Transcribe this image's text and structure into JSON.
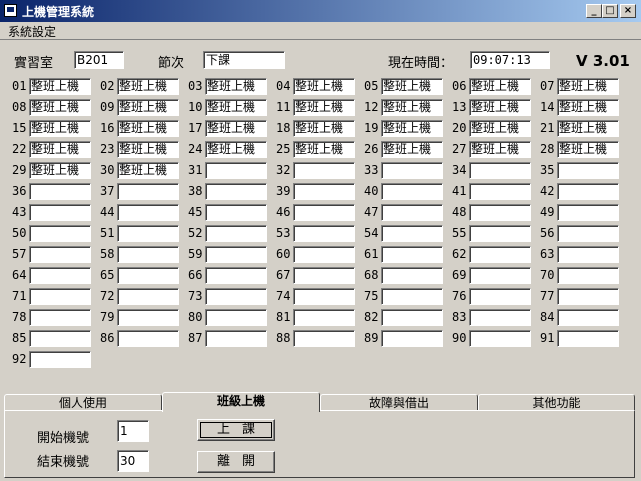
{
  "window": {
    "title": "上機管理系統"
  },
  "menu": {
    "items": [
      "系統設定"
    ]
  },
  "header": {
    "room_label": "實習室",
    "room_value": "B201",
    "period_label": "節次",
    "period_value": "下課",
    "time_label": "現在時間：",
    "time_value": "09:07:13",
    "version": "V 3.01"
  },
  "seats": [
    {
      "num": "01",
      "status": "整班上機"
    },
    {
      "num": "02",
      "status": "整班上機"
    },
    {
      "num": "03",
      "status": "整班上機"
    },
    {
      "num": "04",
      "status": "整班上機"
    },
    {
      "num": "05",
      "status": "整班上機"
    },
    {
      "num": "06",
      "status": "整班上機"
    },
    {
      "num": "07",
      "status": "整班上機"
    },
    {
      "num": "08",
      "status": "整班上機"
    },
    {
      "num": "09",
      "status": "整班上機"
    },
    {
      "num": "10",
      "status": "整班上機"
    },
    {
      "num": "11",
      "status": "整班上機"
    },
    {
      "num": "12",
      "status": "整班上機"
    },
    {
      "num": "13",
      "status": "整班上機"
    },
    {
      "num": "14",
      "status": "整班上機"
    },
    {
      "num": "15",
      "status": "整班上機"
    },
    {
      "num": "16",
      "status": "整班上機"
    },
    {
      "num": "17",
      "status": "整班上機"
    },
    {
      "num": "18",
      "status": "整班上機"
    },
    {
      "num": "19",
      "status": "整班上機"
    },
    {
      "num": "20",
      "status": "整班上機"
    },
    {
      "num": "21",
      "status": "整班上機"
    },
    {
      "num": "22",
      "status": "整班上機"
    },
    {
      "num": "23",
      "status": "整班上機"
    },
    {
      "num": "24",
      "status": "整班上機"
    },
    {
      "num": "25",
      "status": "整班上機"
    },
    {
      "num": "26",
      "status": "整班上機"
    },
    {
      "num": "27",
      "status": "整班上機"
    },
    {
      "num": "28",
      "status": "整班上機"
    },
    {
      "num": "29",
      "status": "整班上機"
    },
    {
      "num": "30",
      "status": "整班上機"
    },
    {
      "num": "31",
      "status": ""
    },
    {
      "num": "32",
      "status": ""
    },
    {
      "num": "33",
      "status": ""
    },
    {
      "num": "34",
      "status": ""
    },
    {
      "num": "35",
      "status": ""
    },
    {
      "num": "36",
      "status": ""
    },
    {
      "num": "37",
      "status": ""
    },
    {
      "num": "38",
      "status": ""
    },
    {
      "num": "39",
      "status": ""
    },
    {
      "num": "40",
      "status": ""
    },
    {
      "num": "41",
      "status": ""
    },
    {
      "num": "42",
      "status": ""
    },
    {
      "num": "43",
      "status": ""
    },
    {
      "num": "44",
      "status": ""
    },
    {
      "num": "45",
      "status": ""
    },
    {
      "num": "46",
      "status": ""
    },
    {
      "num": "47",
      "status": ""
    },
    {
      "num": "48",
      "status": ""
    },
    {
      "num": "49",
      "status": ""
    },
    {
      "num": "50",
      "status": ""
    },
    {
      "num": "51",
      "status": ""
    },
    {
      "num": "52",
      "status": ""
    },
    {
      "num": "53",
      "status": ""
    },
    {
      "num": "54",
      "status": ""
    },
    {
      "num": "55",
      "status": ""
    },
    {
      "num": "56",
      "status": ""
    },
    {
      "num": "57",
      "status": ""
    },
    {
      "num": "58",
      "status": ""
    },
    {
      "num": "59",
      "status": ""
    },
    {
      "num": "60",
      "status": ""
    },
    {
      "num": "61",
      "status": ""
    },
    {
      "num": "62",
      "status": ""
    },
    {
      "num": "63",
      "status": ""
    },
    {
      "num": "64",
      "status": ""
    },
    {
      "num": "65",
      "status": ""
    },
    {
      "num": "66",
      "status": ""
    },
    {
      "num": "67",
      "status": ""
    },
    {
      "num": "68",
      "status": ""
    },
    {
      "num": "69",
      "status": ""
    },
    {
      "num": "70",
      "status": ""
    },
    {
      "num": "71",
      "status": ""
    },
    {
      "num": "72",
      "status": ""
    },
    {
      "num": "73",
      "status": ""
    },
    {
      "num": "74",
      "status": ""
    },
    {
      "num": "75",
      "status": ""
    },
    {
      "num": "76",
      "status": ""
    },
    {
      "num": "77",
      "status": ""
    },
    {
      "num": "78",
      "status": ""
    },
    {
      "num": "79",
      "status": ""
    },
    {
      "num": "80",
      "status": ""
    },
    {
      "num": "81",
      "status": ""
    },
    {
      "num": "82",
      "status": ""
    },
    {
      "num": "83",
      "status": ""
    },
    {
      "num": "84",
      "status": ""
    },
    {
      "num": "85",
      "status": ""
    },
    {
      "num": "86",
      "status": ""
    },
    {
      "num": "87",
      "status": ""
    },
    {
      "num": "88",
      "status": ""
    },
    {
      "num": "89",
      "status": ""
    },
    {
      "num": "90",
      "status": ""
    },
    {
      "num": "91",
      "status": ""
    },
    {
      "num": "92",
      "status": ""
    }
  ],
  "tabs": [
    {
      "label": "個人使用",
      "active": false
    },
    {
      "label": "班級上機",
      "active": true
    },
    {
      "label": "故障與借出",
      "active": false
    },
    {
      "label": "其他功能",
      "active": false
    }
  ],
  "panel": {
    "start_label": "開始機號",
    "start_value": "1",
    "end_label": "結束機號",
    "end_value": "30",
    "start_button": "上課",
    "leave_button": "離開"
  }
}
